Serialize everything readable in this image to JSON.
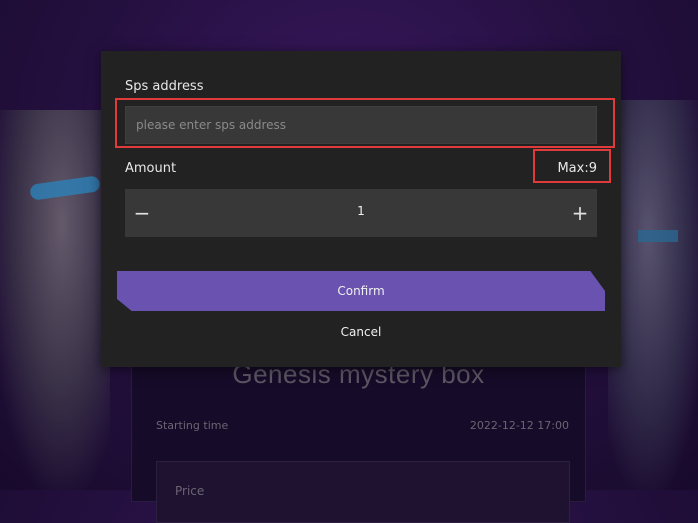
{
  "background": {
    "card_title": "Genesis mystery box",
    "starting_time_label": "Starting time",
    "starting_time_value": "2022-12-12 17:00",
    "price_label": "Price"
  },
  "modal": {
    "address_label": "Sps address",
    "address_placeholder": "please enter sps address",
    "address_value": "",
    "amount_label": "Amount",
    "max_label": "Max:9",
    "amount_value": "1",
    "minus_symbol": "−",
    "plus_symbol": "+",
    "confirm_label": "Confirm",
    "cancel_label": "Cancel"
  },
  "colors": {
    "accent": "#6a53b0",
    "highlight": "#e03a3a",
    "modal_bg": "#222222",
    "field_bg": "#383838"
  }
}
